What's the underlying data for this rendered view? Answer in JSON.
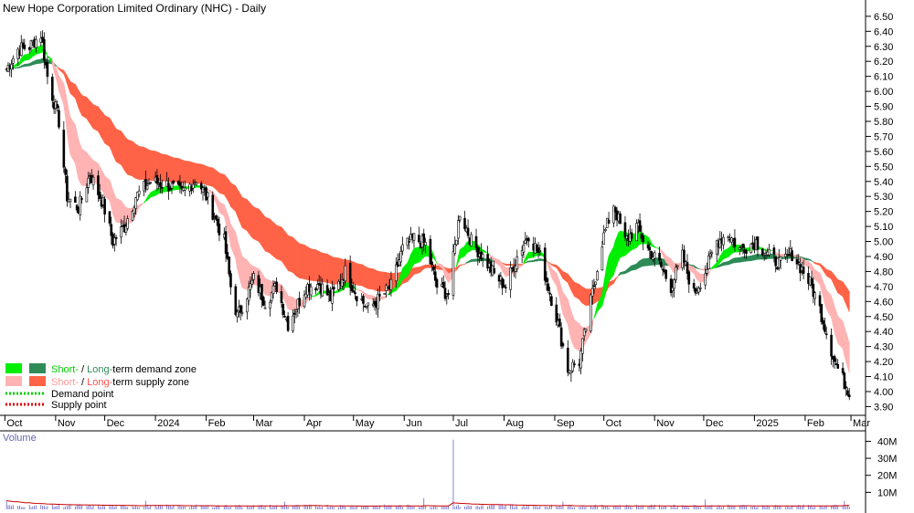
{
  "chart_data": {
    "type": "candlestick",
    "title": "New Hope Corporation Limited Ordinary (NHC) - Daily",
    "price_axis": {
      "ticks": [
        "3.90",
        "4.00",
        "4.10",
        "4.20",
        "4.30",
        "4.40",
        "4.50",
        "4.60",
        "4.70",
        "4.80",
        "4.90",
        "5.00",
        "5.10",
        "5.20",
        "5.30",
        "5.40",
        "5.50",
        "5.60",
        "5.70",
        "5.80",
        "5.90",
        "6.00",
        "6.10",
        "6.20",
        "6.30",
        "6.40",
        "6.50"
      ],
      "ylim": [
        3.86,
        6.56
      ]
    },
    "volume_axis": {
      "label": "Volume",
      "ticks": [
        "10M",
        "20M",
        "30M",
        "40M"
      ],
      "ylim": [
        0,
        44
      ]
    },
    "x_months": [
      "Oct",
      "Nov",
      "Dec",
      "2024",
      "Feb",
      "Mar",
      "Apr",
      "May",
      "Jun",
      "Jul",
      "Aug",
      "Sep",
      "Oct",
      "Nov",
      "Dec",
      "2025",
      "Feb",
      "Mar"
    ],
    "price_path": [
      [
        "2023-10-02",
        6.15
      ],
      [
        "2023-10-09",
        6.28
      ],
      [
        "2023-10-16",
        6.3
      ],
      [
        "2023-10-23",
        6.38
      ],
      [
        "2023-10-27",
        6.1
      ],
      [
        "2023-11-03",
        5.8
      ],
      [
        "2023-11-08",
        5.3
      ],
      [
        "2023-11-15",
        5.22
      ],
      [
        "2023-11-22",
        5.45
      ],
      [
        "2023-11-30",
        5.25
      ],
      [
        "2023-12-06",
        5.0
      ],
      [
        "2023-12-13",
        5.1
      ],
      [
        "2023-12-20",
        5.3
      ],
      [
        "2023-12-29",
        5.4
      ],
      [
        "2024-01-08",
        5.38
      ],
      [
        "2024-01-17",
        5.32
      ],
      [
        "2024-01-26",
        5.42
      ],
      [
        "2024-02-02",
        5.28
      ],
      [
        "2024-02-12",
        5.0
      ],
      [
        "2024-02-16",
        4.7
      ],
      [
        "2024-02-20",
        4.5
      ],
      [
        "2024-03-01",
        4.75
      ],
      [
        "2024-03-08",
        4.6
      ],
      [
        "2024-03-15",
        4.7
      ],
      [
        "2024-03-22",
        4.45
      ],
      [
        "2024-04-02",
        4.7
      ],
      [
        "2024-04-10",
        4.72
      ],
      [
        "2024-04-17",
        4.62
      ],
      [
        "2024-04-26",
        4.8
      ],
      [
        "2024-05-03",
        4.65
      ],
      [
        "2024-05-10",
        4.55
      ],
      [
        "2024-05-17",
        4.62
      ],
      [
        "2024-05-24",
        4.7
      ],
      [
        "2024-05-31",
        4.95
      ],
      [
        "2024-06-07",
        5.02
      ],
      [
        "2024-06-14",
        4.98
      ],
      [
        "2024-06-21",
        4.7
      ],
      [
        "2024-06-28",
        4.65
      ],
      [
        "2024-07-05",
        5.2
      ],
      [
        "2024-07-12",
        5.0
      ],
      [
        "2024-07-19",
        4.9
      ],
      [
        "2024-07-26",
        4.78
      ],
      [
        "2024-08-02",
        4.7
      ],
      [
        "2024-08-09",
        4.9
      ],
      [
        "2024-08-16",
        5.05
      ],
      [
        "2024-08-23",
        4.9
      ],
      [
        "2024-09-02",
        4.5
      ],
      [
        "2024-09-09",
        4.15
      ],
      [
        "2024-09-16",
        4.2
      ],
      [
        "2024-09-23",
        4.6
      ],
      [
        "2024-09-30",
        5.0
      ],
      [
        "2024-10-07",
        5.25
      ],
      [
        "2024-10-14",
        5.0
      ],
      [
        "2024-10-21",
        5.1
      ],
      [
        "2024-10-28",
        4.95
      ],
      [
        "2024-11-04",
        4.85
      ],
      [
        "2024-11-11",
        4.7
      ],
      [
        "2024-11-18",
        4.9
      ],
      [
        "2024-11-25",
        4.65
      ],
      [
        "2024-12-02",
        4.8
      ],
      [
        "2024-12-09",
        5.0
      ],
      [
        "2024-12-16",
        5.05
      ],
      [
        "2024-12-23",
        4.95
      ],
      [
        "2025-01-02",
        5.0
      ],
      [
        "2025-01-10",
        4.9
      ],
      [
        "2025-01-17",
        4.85
      ],
      [
        "2025-01-24",
        4.92
      ],
      [
        "2025-01-31",
        4.8
      ],
      [
        "2025-02-05",
        4.7
      ],
      [
        "2025-02-10",
        4.55
      ],
      [
        "2025-02-14",
        4.4
      ],
      [
        "2025-02-19",
        4.2
      ],
      [
        "2025-02-24",
        4.08
      ],
      [
        "2025-02-28",
        4.0
      ]
    ],
    "zones": {
      "short_term_demand_color": "#00ee00",
      "long_term_demand_color": "#2e8b57",
      "short_term_supply_color": "#ffb3b3",
      "long_term_supply_color": "#ff6347",
      "overlap_color": "#ff6600"
    },
    "legend": {
      "demand_zone": {
        "short": "Short-",
        "sep": " / ",
        "long": "Long-",
        "rest": "term demand zone"
      },
      "supply_zone": {
        "short": "Short-",
        "sep": " / ",
        "long": "Long-",
        "rest": "term supply zone"
      },
      "demand_point": "Demand point",
      "supply_point": "Supply point",
      "demand_point_color": "#00cc00",
      "supply_point_color": "#dd0000",
      "short_demand_text_color": "#00cc00",
      "long_demand_text_color": "#2e8b57",
      "short_supply_text_color": "#ff9999",
      "long_supply_text_color": "#ff5050"
    },
    "colors": {
      "volume_bars": "#6666cc",
      "volume_average": "#cc0000",
      "volume_label": "#6666aa",
      "candles": "#000000"
    }
  }
}
